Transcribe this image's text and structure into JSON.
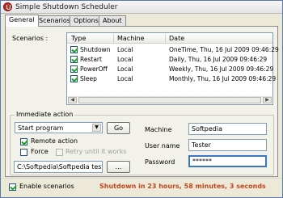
{
  "window": {
    "title": "Simple Shutdown Scheduler"
  },
  "tabs": [
    {
      "label": "General",
      "active": true
    },
    {
      "label": "Scenarios",
      "active": false
    },
    {
      "label": "Options",
      "active": false
    },
    {
      "label": "About",
      "active": false
    }
  ],
  "scenarios": {
    "label": "Scenarios :",
    "columns": [
      "Type",
      "Machine",
      "Date"
    ],
    "rows": [
      {
        "checked": true,
        "type": "Shutdown",
        "machine": "Local",
        "date": "OneTime, Thu, 16 Jul 2009 09:46:29"
      },
      {
        "checked": true,
        "type": "Restart",
        "machine": "Local",
        "date": "Daily, Thu, 16 Jul 2009 09:46:29"
      },
      {
        "checked": true,
        "type": "PowerOff",
        "machine": "Local",
        "date": "Weekly, Thu, 16 Jul 2009 09:46:29"
      },
      {
        "checked": true,
        "type": "Sleep",
        "machine": "Local",
        "date": "Monthly, Thu, 16 Jul 2009 09:46:29"
      }
    ]
  },
  "immediate_action": {
    "title": "Immediate action",
    "action_select": "Start program",
    "go_label": "Go",
    "remote_action": {
      "label": "Remote action",
      "checked": true
    },
    "force": {
      "label": "Force",
      "checked": false
    },
    "retry": {
      "label": "Retry until it works",
      "checked": false
    },
    "program_path": "C:\\Softpedia\\Softpedia test.ex",
    "browse_label": "...",
    "machine_label": "Machine",
    "machine_value": "Softpedia",
    "username_label": "User name",
    "username_value": "Tester",
    "password_label": "Password",
    "password_value": "******"
  },
  "footer": {
    "enable_scenarios": {
      "label": "Enable scenarios",
      "checked": true
    },
    "status": "Shutdown in 23 hours, 58 minutes, 3 seconds"
  },
  "colors": {
    "status_text": "#c4461b",
    "check_mark": "#21a121",
    "focus_border": "#3b78c3"
  }
}
